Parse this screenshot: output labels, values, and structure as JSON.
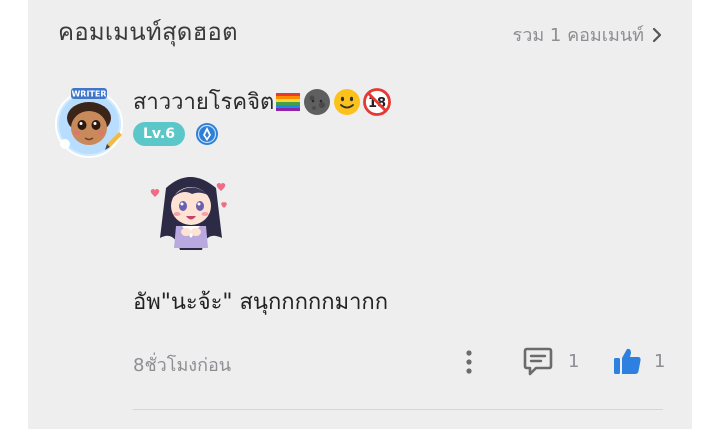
{
  "section": {
    "title": "คอมเมนท์สุดฮอต",
    "all_comments_link": "รวม 1 คอมเมนท์"
  },
  "comment": {
    "username": "สาววายโรคจิต",
    "username_emojis": [
      "rainbow-flag-icon",
      "new-moon-face-icon",
      "slightly-smiling-face-icon",
      "no-under-18-icon"
    ],
    "avatar_tag": "WRITER",
    "level_badge": "Lv.6",
    "role_badge_icon": "writer-badge-icon",
    "sticker_icon": "anime-girl-sticker",
    "text": "อัพ\"นะจ้ะ\" สนุกกกกกมากก",
    "timestamp": "8ชั่วโมงก่อน",
    "reply_count": "1",
    "like_count": "1"
  },
  "colors": {
    "panel": "#eeeeef",
    "level_badge": "#5cc7c9",
    "like_icon": "#2d7fe0",
    "muted_text": "#8e8e93"
  }
}
